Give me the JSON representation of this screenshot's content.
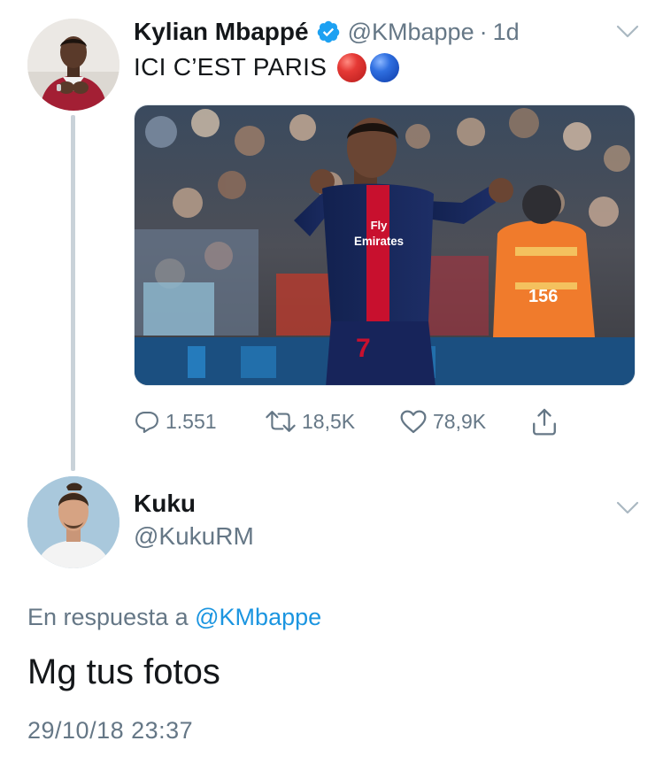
{
  "tweet": {
    "display_name": "Kylian Mbappé",
    "handle": "@KMbappe",
    "separator": "·",
    "time": "1d",
    "text": "ICI C’EST PARIS",
    "media": {
      "shirt_sponsor_line1": "Fly",
      "shirt_sponsor_line2": "Emirates",
      "shirt_number": "7",
      "steward_number": "156"
    },
    "actions": {
      "replies": "1.551",
      "retweets": "18,5K",
      "likes": "78,9K"
    }
  },
  "reply": {
    "display_name": "Kuku",
    "handle": "@KukuRM",
    "replying_prefix": "En respuesta a",
    "replying_to": "@KMbappe",
    "text": "Mg tus fotos",
    "timestamp": "29/10/18 23:37"
  },
  "colors": {
    "link": "#1b95e0",
    "secondary_text": "#657786",
    "primary_text": "#14171a",
    "thread_line": "#c9d2d9",
    "verified": "#1da1f2"
  }
}
